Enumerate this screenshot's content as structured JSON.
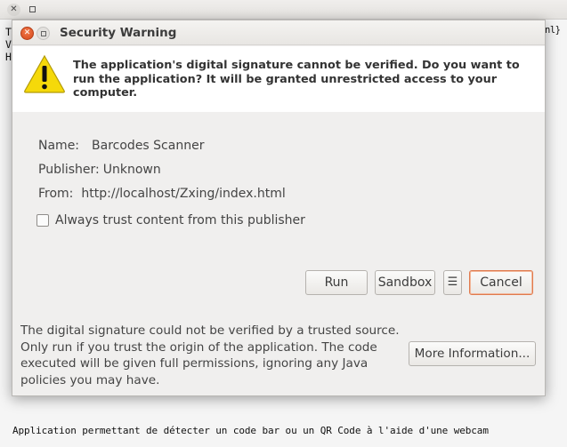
{
  "background_window": {
    "left_fragments": [
      "T",
      "V",
      "H"
    ],
    "right_fragment": "nl}",
    "footer_text": "Application permettant de détecter un code bar ou un QR Code à l'aide d'une webcam"
  },
  "dialog": {
    "title": "Security Warning",
    "header_message": "The application's digital signature cannot be verified. Do you want to run the application? It will be granted unrestricted access to your computer.",
    "name_label": "Name:",
    "name_value": "Barcodes Scanner",
    "publisher_label": "Publisher:",
    "publisher_value": "Unknown",
    "from_label": "From:",
    "from_value": "http://localhost/Zxing/index.html",
    "trust_checkbox_label": "Always trust content from this publisher",
    "trust_checked": false,
    "buttons": {
      "run": "Run",
      "sandbox": "Sandbox",
      "menu": "☰",
      "cancel": "Cancel",
      "more_info": "More Information..."
    },
    "footer_message": "The digital signature could not be verified by a trusted source. Only run if you trust the origin of the application. The code executed will be given full permissions, ignoring any Java policies you may have."
  },
  "icons": {
    "warning": "warning-triangle-icon",
    "close": "close-icon",
    "maximize": "maximize-icon"
  },
  "colors": {
    "warning_yellow": "#f5d90a",
    "cancel_focus": "#e07a4e",
    "close_orange": "#e2562a"
  }
}
